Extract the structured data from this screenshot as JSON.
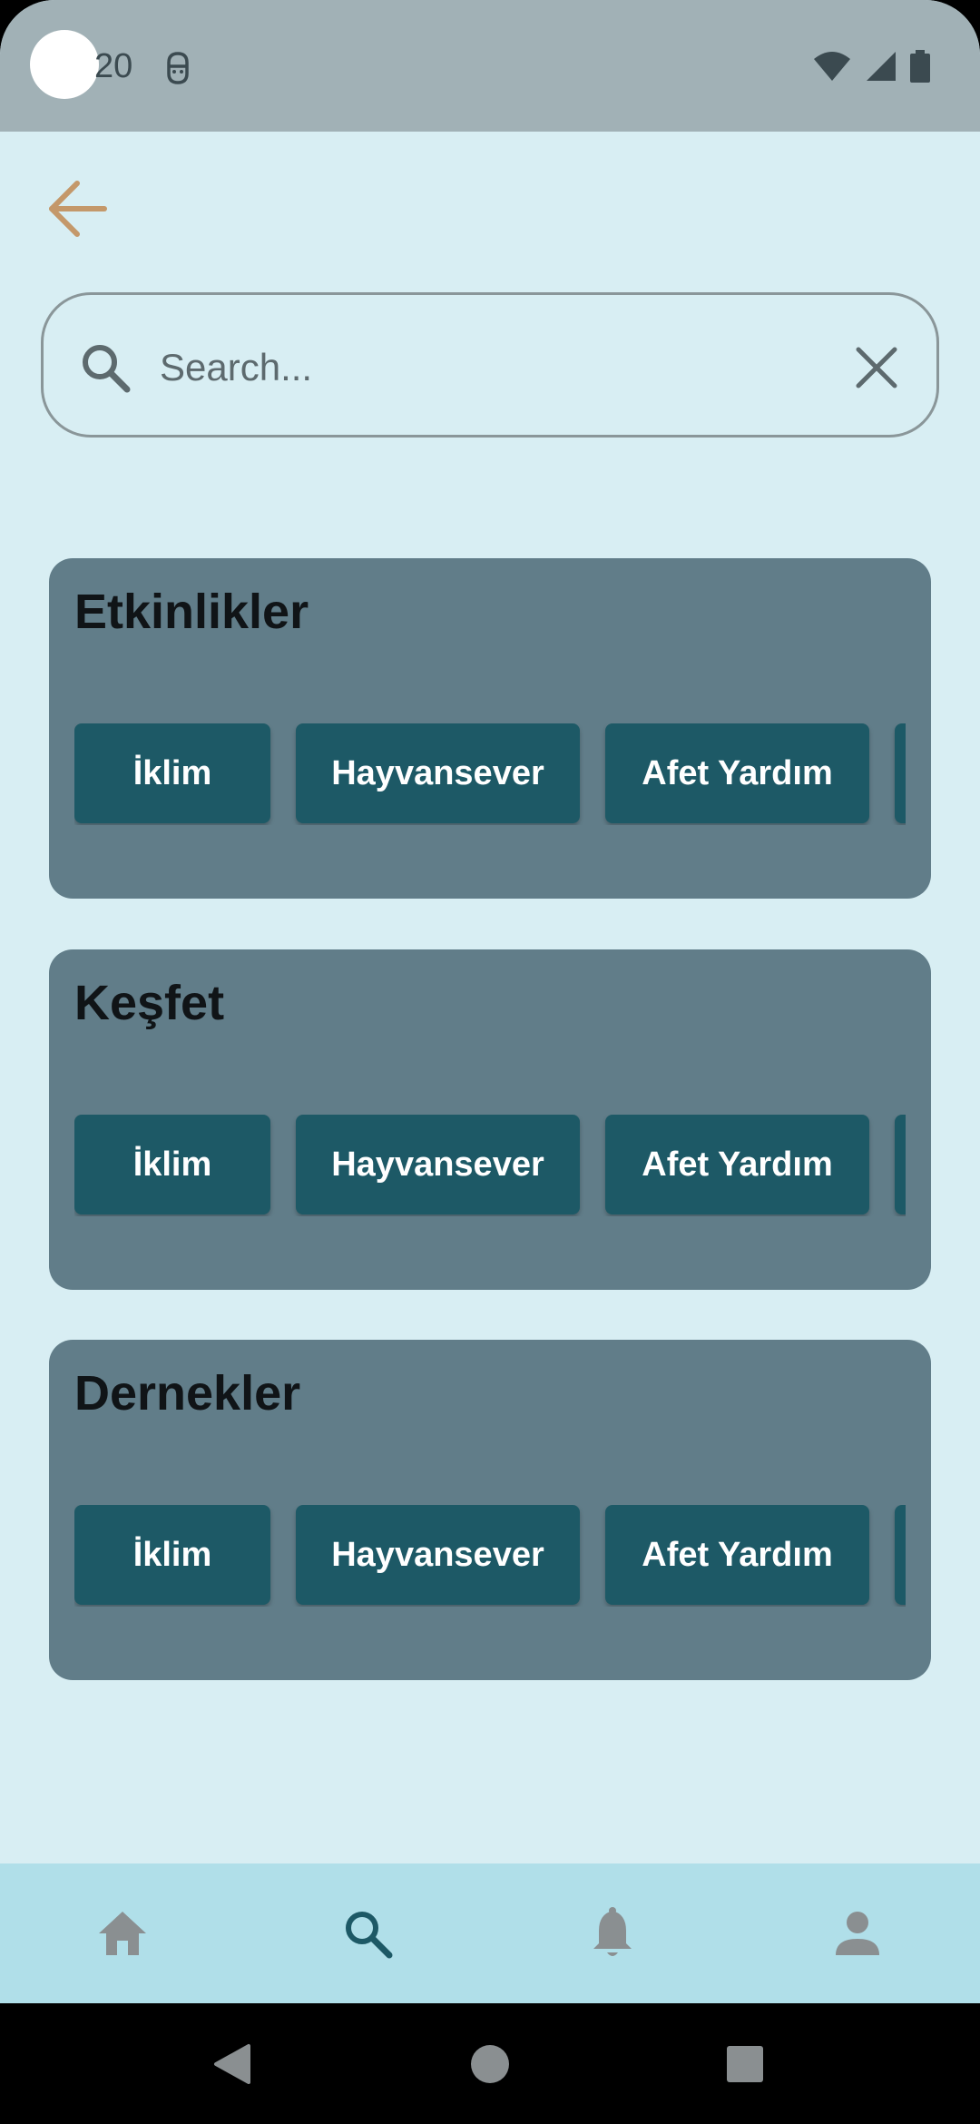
{
  "status_bar": {
    "time": "20",
    "icons": [
      "face-icon",
      "wifi-icon",
      "signal-icon",
      "battery-icon"
    ]
  },
  "header": {
    "back_icon": "arrow-left-icon"
  },
  "search": {
    "placeholder": "Search...",
    "value": "",
    "search_icon": "search-icon",
    "clear_icon": "close-icon"
  },
  "sections": [
    {
      "title": "Etkinlikler",
      "chips": [
        "İklim",
        "Hayvansever",
        "Afet Yardım"
      ]
    },
    {
      "title": "Keşfet",
      "chips": [
        "İklim",
        "Hayvansever",
        "Afet Yardım"
      ]
    },
    {
      "title": "Dernekler",
      "chips": [
        "İklim",
        "Hayvansever",
        "Afet Yardım"
      ]
    }
  ],
  "bottom_nav": {
    "items": [
      "home-icon",
      "search-icon",
      "bell-icon",
      "person-icon"
    ],
    "active": "search-icon"
  },
  "system_nav": {
    "items": [
      "back-triangle-icon",
      "home-circle-icon",
      "recents-square-icon"
    ]
  },
  "colors": {
    "background": "#d8eef3",
    "status_bar": "#a1b1b6",
    "card": "#617d89",
    "chip": "#1d5966",
    "back_arrow": "#c4986a",
    "nav_bar": "#b0dfe9",
    "nav_active": "#1d5966",
    "nav_inactive": "#8a8f91"
  }
}
